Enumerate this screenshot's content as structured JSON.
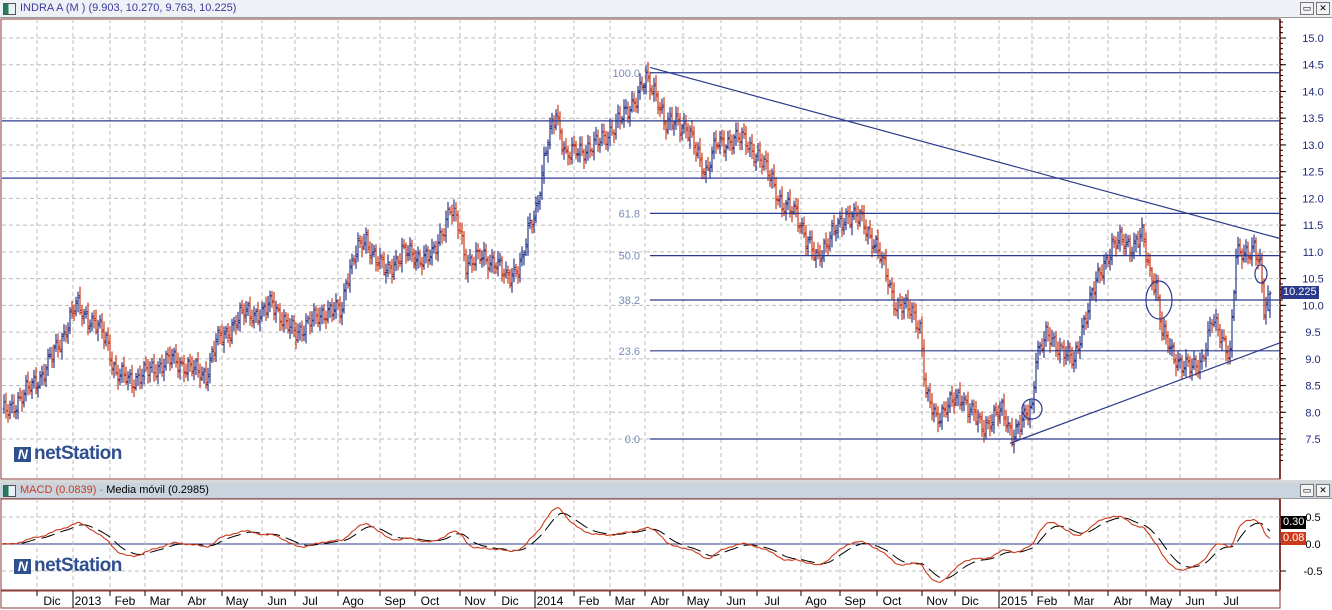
{
  "main_panel": {
    "title": "INDRA A (M ) (9.903, 10.270, 9.763, 10.225)",
    "last_price": "10.225",
    "logo": "netStation"
  },
  "macd_panel": {
    "title_macd": "MACD (0.0839)",
    "title_sep": " - ",
    "title_signal": "Media móvil (0.2985)",
    "last_signal": "0.30",
    "last_macd": "0.08",
    "logo": "netStation"
  },
  "window_buttons": {
    "restore": "▭",
    "close": "✕"
  },
  "colors": {
    "up": "#2b3a8c",
    "down": "#cc3a1a",
    "line": "#2b3a8c",
    "grid": "#bdbdbd",
    "border": "#8b3a3a",
    "macd": "#cc3a1a",
    "signal": "#000000"
  },
  "chart_data": [
    {
      "type": "ohlc",
      "title": "INDRA A (M )",
      "ylim": [
        7.0,
        15.3
      ],
      "yticks": [
        "15.0",
        "14.5",
        "14.0",
        "13.5",
        "13.0",
        "12.5",
        "12.0",
        "11.5",
        "11.0",
        "10.5",
        "10.0",
        "9.5",
        "9.0",
        "8.5",
        "8.0",
        "7.5"
      ],
      "xticks": [
        "Dic",
        "2013",
        "Feb",
        "Mar",
        "Abr",
        "May",
        "Jun",
        "Jul",
        "Ago",
        "Sep",
        "Oct",
        "Nov",
        "Dic",
        "2014",
        "Feb",
        "Mar",
        "Abr",
        "May",
        "Jun",
        "Jul",
        "Ago",
        "Sep",
        "Oct",
        "Nov",
        "Dic",
        "2015",
        "Feb",
        "Mar",
        "Abr",
        "May",
        "Jun",
        "Jul"
      ],
      "last_ohlc": {
        "open": 9.903,
        "high": 10.27,
        "low": 9.763,
        "close": 10.225
      },
      "close_series_trading_day": [
        [
          2,
          8.0
        ],
        [
          10,
          8.3
        ],
        [
          20,
          8.7
        ],
        [
          30,
          9.4
        ],
        [
          37,
          10.0
        ],
        [
          45,
          9.7
        ],
        [
          52,
          9.4
        ],
        [
          57,
          8.7
        ],
        [
          65,
          8.6
        ],
        [
          75,
          8.8
        ],
        [
          85,
          9.0
        ],
        [
          95,
          8.8
        ],
        [
          102,
          8.7
        ],
        [
          107,
          9.3
        ],
        [
          115,
          9.6
        ],
        [
          122,
          9.9
        ],
        [
          130,
          9.8
        ],
        [
          135,
          10.1
        ],
        [
          142,
          9.6
        ],
        [
          147,
          9.5
        ],
        [
          155,
          9.7
        ],
        [
          162,
          9.9
        ],
        [
          170,
          9.9
        ],
        [
          172,
          10.5
        ],
        [
          177,
          11.0
        ],
        [
          182,
          11.2
        ],
        [
          187,
          10.9
        ],
        [
          192,
          10.6
        ],
        [
          200,
          11.0
        ],
        [
          207,
          10.9
        ],
        [
          215,
          10.9
        ],
        [
          220,
          11.4
        ],
        [
          224,
          11.8
        ],
        [
          229,
          11.4
        ],
        [
          232,
          10.8
        ],
        [
          240,
          10.9
        ],
        [
          247,
          10.8
        ],
        [
          252,
          10.5
        ],
        [
          260,
          10.8
        ],
        [
          264,
          11.5
        ],
        [
          267,
          11.8
        ],
        [
          272,
          12.9
        ],
        [
          277,
          13.6
        ],
        [
          282,
          12.8
        ],
        [
          290,
          12.9
        ],
        [
          297,
          13.0
        ],
        [
          305,
          13.3
        ],
        [
          310,
          13.5
        ],
        [
          317,
          13.9
        ],
        [
          322,
          14.2
        ],
        [
          327,
          14.0
        ],
        [
          332,
          13.3
        ],
        [
          337,
          13.5
        ],
        [
          342,
          13.3
        ],
        [
          347,
          12.9
        ],
        [
          352,
          12.5
        ],
        [
          357,
          13.0
        ],
        [
          365,
          13.1
        ],
        [
          372,
          13.1
        ],
        [
          377,
          12.8
        ],
        [
          385,
          12.4
        ],
        [
          390,
          11.8
        ],
        [
          397,
          11.8
        ],
        [
          402,
          11.2
        ],
        [
          407,
          10.9
        ],
        [
          415,
          11.3
        ],
        [
          422,
          11.7
        ],
        [
          430,
          11.6
        ],
        [
          437,
          11.1
        ],
        [
          442,
          10.6
        ],
        [
          447,
          10.0
        ],
        [
          455,
          9.9
        ],
        [
          459,
          9.6
        ],
        [
          462,
          8.3
        ],
        [
          467,
          7.9
        ],
        [
          472,
          8.1
        ],
        [
          480,
          8.3
        ],
        [
          485,
          8.0
        ],
        [
          490,
          7.7
        ],
        [
          495,
          7.9
        ],
        [
          500,
          8.0
        ],
        [
          505,
          7.6
        ],
        [
          510,
          7.8
        ],
        [
          515,
          8.1
        ],
        [
          517,
          9.1
        ],
        [
          522,
          9.4
        ],
        [
          530,
          9.2
        ],
        [
          536,
          8.9
        ],
        [
          540,
          9.6
        ],
        [
          545,
          10.2
        ],
        [
          550,
          10.7
        ],
        [
          555,
          11.1
        ],
        [
          560,
          11.2
        ],
        [
          565,
          11.1
        ],
        [
          570,
          11.3
        ],
        [
          574,
          10.6
        ],
        [
          577,
          10.4
        ],
        [
          580,
          9.5
        ],
        [
          585,
          9.1
        ],
        [
          590,
          8.9
        ],
        [
          595,
          8.8
        ],
        [
          600,
          9.0
        ],
        [
          605,
          9.7
        ],
        [
          610,
          9.4
        ],
        [
          614,
          9.1
        ],
        [
          617,
          10.9
        ],
        [
          622,
          11.0
        ],
        [
          626,
          11.1
        ],
        [
          629,
          10.7
        ],
        [
          631,
          9.9
        ],
        [
          634,
          10.2
        ]
      ],
      "fibonacci": [
        {
          "label": "100.0",
          "price": 14.35
        },
        {
          "label": "61.8",
          "price": 11.72
        },
        {
          "label": "50.0",
          "price": 10.93
        },
        {
          "label": "38.2",
          "price": 10.1
        },
        {
          "label": "23.6",
          "price": 9.15
        },
        {
          "label": "0.0",
          "price": 7.5
        }
      ],
      "horizontal_lines": [
        13.45,
        12.38
      ]
    },
    {
      "type": "line",
      "title": "MACD",
      "ylim": [
        -0.75,
        0.75
      ],
      "yticks": [
        "0.5",
        "0.0",
        "-0.5"
      ],
      "series": [
        {
          "name": "MACD",
          "last": 0.0839
        },
        {
          "name": "Media móvil",
          "last": 0.2985
        }
      ]
    }
  ]
}
